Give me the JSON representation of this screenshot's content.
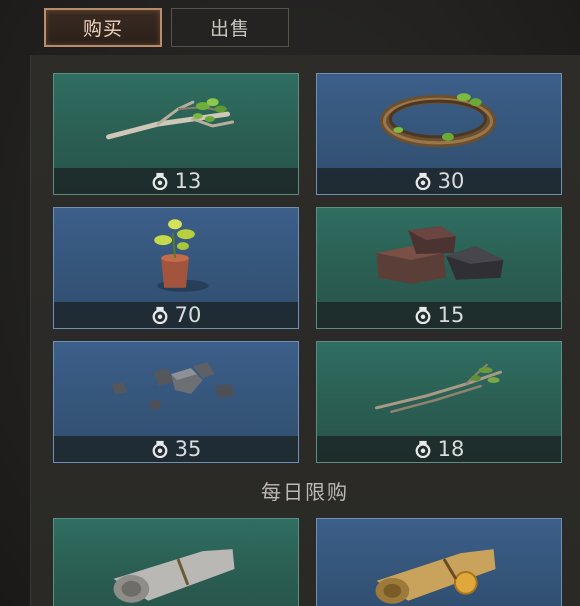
{
  "tabs": {
    "buy": "购买",
    "sell": "出售"
  },
  "items": [
    {
      "name": "branch",
      "price": "13",
      "rarity": "green"
    },
    {
      "name": "vine-wreath",
      "price": "30",
      "rarity": "blue"
    },
    {
      "name": "sapling",
      "price": "70",
      "rarity": "blue"
    },
    {
      "name": "coal",
      "price": "15",
      "rarity": "green"
    },
    {
      "name": "iron-ore",
      "price": "35",
      "rarity": "blue"
    },
    {
      "name": "twigs",
      "price": "18",
      "rarity": "green"
    },
    {
      "name": "gray-scroll",
      "price": "",
      "rarity": "green"
    },
    {
      "name": "gold-scroll",
      "price": "",
      "rarity": "blue"
    }
  ],
  "daily_limit_title": "每日限购",
  "colors": {
    "green_card": "#2b5d52",
    "blue_card": "#355579",
    "active_tab_border": "#b98d6a"
  },
  "icons": {
    "currency": "medal-coin-icon"
  }
}
